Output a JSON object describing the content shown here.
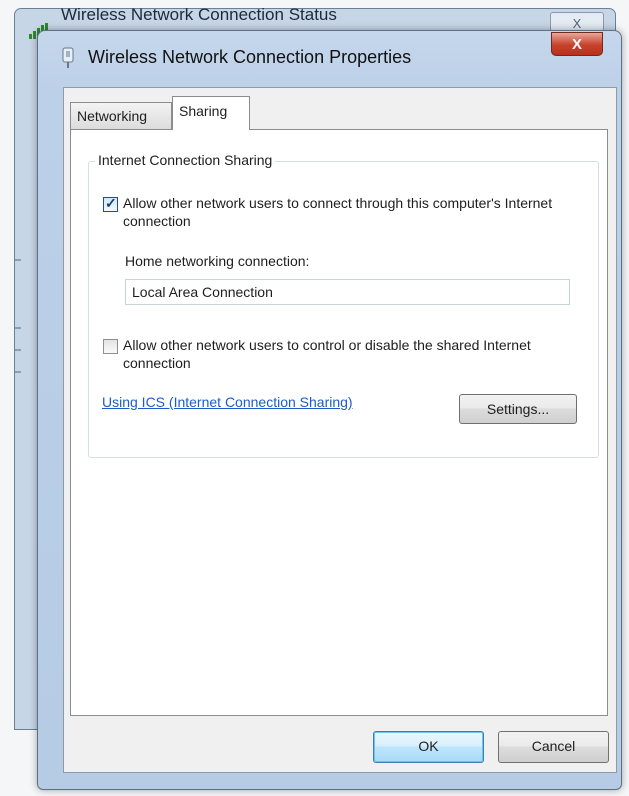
{
  "background_window": {
    "title": "Wireless Network Connection Status",
    "close_glyph": "X"
  },
  "dialog": {
    "title": "Wireless Network Connection Properties",
    "close_glyph": "X"
  },
  "tabs": [
    {
      "label": "Networking",
      "selected": false
    },
    {
      "label": "Sharing",
      "selected": true
    }
  ],
  "sharing": {
    "group_title": "Internet Connection Sharing",
    "allow_connect": {
      "label": "Allow other network users to connect through this computer's Internet connection",
      "checked": true
    },
    "home_networking": {
      "label": "Home networking connection:",
      "value": "Local Area Connection"
    },
    "allow_control": {
      "label": "Allow other network users to control or disable the shared Internet connection",
      "checked": false
    },
    "ics_link": "Using ICS (Internet Connection Sharing)",
    "settings_button": "Settings..."
  },
  "footer": {
    "ok_label": "OK",
    "cancel_label": "Cancel"
  },
  "colors": {
    "title_bar": "#bcd0e8",
    "close_button": "#c7412b",
    "link": "#1c5cc9",
    "default_button": "#bee6fd"
  }
}
